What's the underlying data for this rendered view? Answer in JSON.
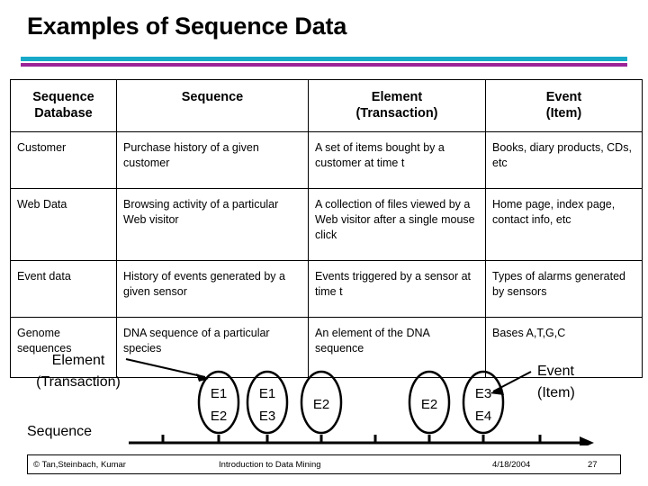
{
  "slide": {
    "title": "Examples of Sequence Data",
    "accent_teal": "#18A9C9",
    "accent_purple": "#9B2397"
  },
  "table": {
    "headers": [
      "Sequence\nDatabase",
      "Sequence",
      "Element\n(Transaction)",
      "Event\n(Item)"
    ],
    "headers_flat": {
      "c0_l1": "Sequence",
      "c0_l2": "Database",
      "c1_l1": "Sequence",
      "c2_l1": "Element",
      "c2_l2": "(Transaction)",
      "c3_l1": "Event",
      "c3_l2": "(Item)"
    },
    "rows": [
      {
        "database": "Customer",
        "sequence": "Purchase history of a given customer",
        "element": "A set of items bought by a customer at time t",
        "event": "Books, diary products, CDs, etc"
      },
      {
        "database": "Web Data",
        "sequence": "Browsing activity of a particular Web visitor",
        "element": "A collection of files viewed by a Web visitor after a single mouse click",
        "event": "Home page, index page, contact info, etc"
      },
      {
        "database": "Event data",
        "sequence": "History of events generated by a given sensor",
        "element": "Events triggered by a sensor at time t",
        "event": "Types of alarms generated by sensors"
      },
      {
        "database": "Genome sequences",
        "sequence": "DNA sequence of a particular species",
        "element": "An element of the DNA sequence",
        "event": "Bases A,T,G,C"
      }
    ]
  },
  "diagram": {
    "element_label_line1": "Element",
    "element_label_line2": "(Transaction)",
    "event_label_line1": "Event",
    "event_label_line2": "(Item)",
    "sequence_label": "Sequence",
    "elements": [
      {
        "items": [
          "E1",
          "E2"
        ]
      },
      {
        "items": [
          "E1",
          "E3"
        ]
      },
      {
        "items": [
          "E2"
        ]
      },
      {
        "items": [
          "E2"
        ]
      },
      {
        "items": [
          "E3",
          "E4"
        ]
      }
    ]
  },
  "footer": {
    "copyright": "© Tan,Steinbach, Kumar",
    "book_title": "Introduction to Data Mining",
    "date": "4/18/2004",
    "page_number": "27"
  }
}
